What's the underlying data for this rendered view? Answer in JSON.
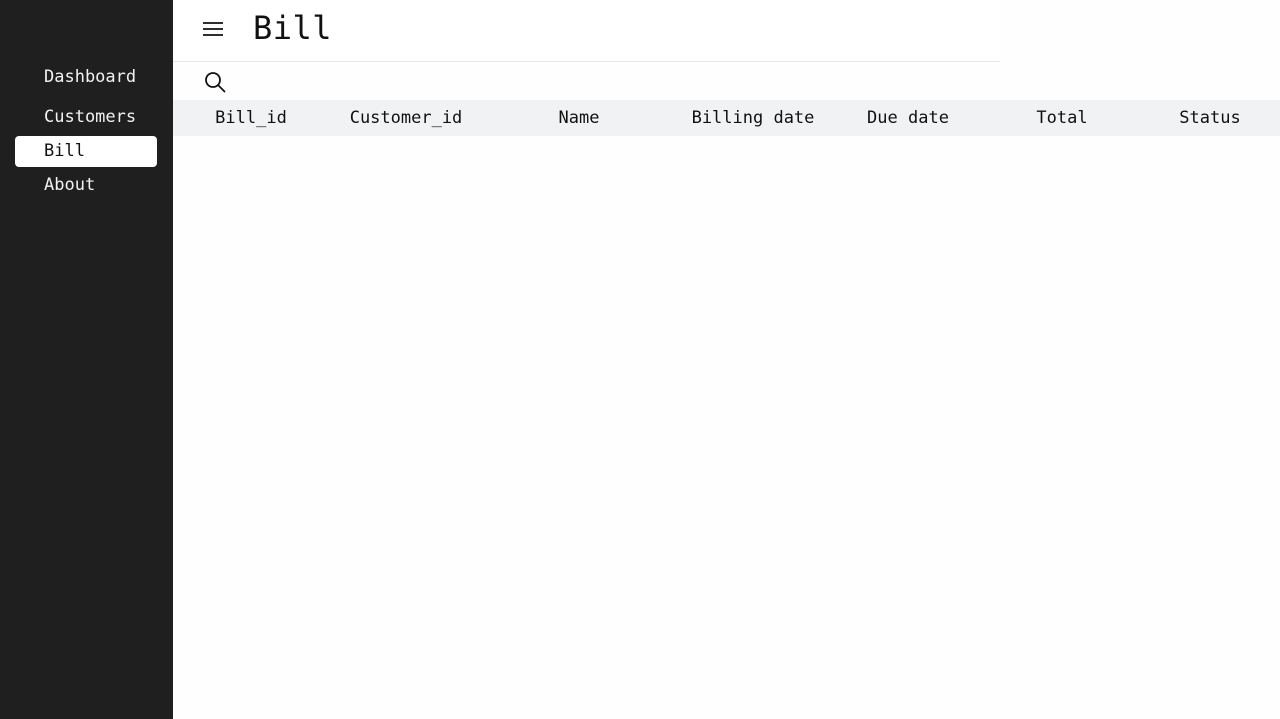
{
  "sidebar": {
    "items": [
      {
        "label": "Dashboard"
      },
      {
        "label": "Customers"
      },
      {
        "label": "Bill",
        "active": true
      },
      {
        "label": "About"
      }
    ]
  },
  "header": {
    "title": "Bill",
    "menu_icon": "hamburger-menu-icon",
    "search_icon": "search-icon"
  },
  "table": {
    "columns": [
      "Bill_id",
      "Customer_id",
      "Name",
      "Billing date",
      "Due date",
      "Total",
      "Status"
    ],
    "rows": []
  },
  "colors": {
    "sidebar_bg": "#1f1f1f",
    "active_item_bg": "#ffffff",
    "table_header_bg": "#f1f2f4"
  }
}
